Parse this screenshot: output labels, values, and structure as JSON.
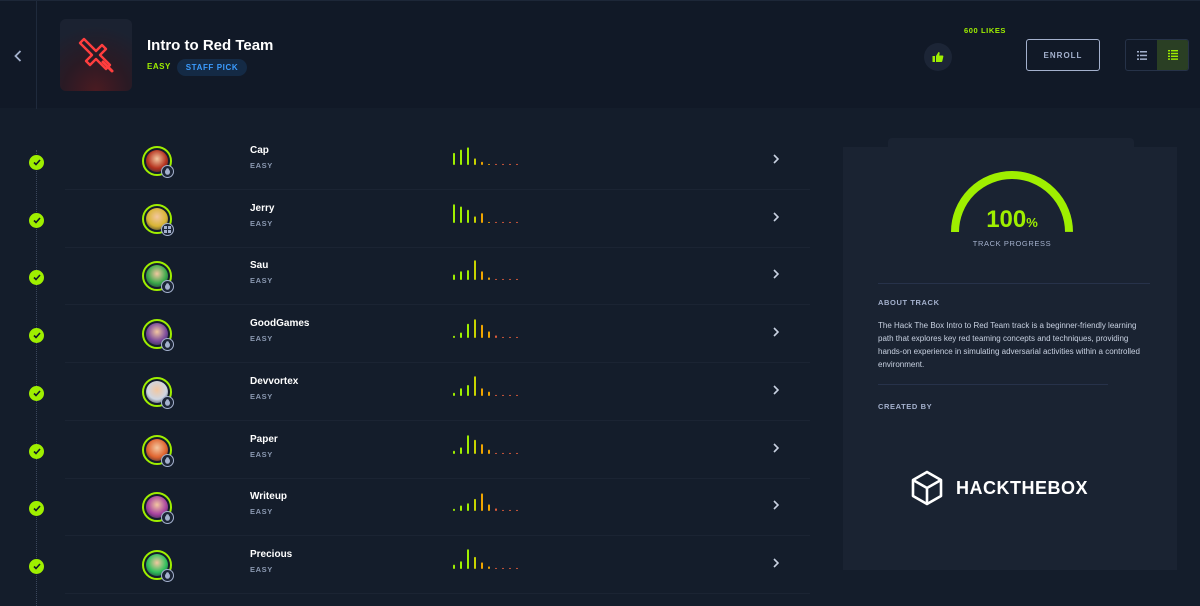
{
  "header": {
    "title": "Intro to Red Team",
    "difficulty": "EASY",
    "badge": "STAFF PICK",
    "likes": "600 LIKES",
    "enroll": "ENROLL"
  },
  "colors": {
    "accent": "#9fef00",
    "background": "#141d2b",
    "panel": "#1a2332",
    "badge_text": "#3b9cff",
    "rating_mid": "#f0a500",
    "rating_low": "#e35d3c",
    "track_icon": "#ff3e3e"
  },
  "machines": [
    {
      "name": "Cap",
      "difficulty": "EASY",
      "os": "linux",
      "face": "#b5331f",
      "ratings": [
        0.55,
        0.7,
        0.8,
        0.3,
        0.15,
        0.05,
        0.05,
        0.05,
        0.05,
        0.05
      ]
    },
    {
      "name": "Jerry",
      "difficulty": "EASY",
      "os": "windows",
      "face": "#d8b434",
      "ratings": [
        0.85,
        0.75,
        0.6,
        0.3,
        0.45,
        0.05,
        0.05,
        0.05,
        0.05,
        0.05
      ]
    },
    {
      "name": "Sau",
      "difficulty": "EASY",
      "os": "linux",
      "face": "#3aa84a",
      "ratings": [
        0.25,
        0.4,
        0.45,
        0.9,
        0.4,
        0.12,
        0.05,
        0.05,
        0.05,
        0.05
      ]
    },
    {
      "name": "GoodGames",
      "difficulty": "EASY",
      "os": "linux",
      "face": "#7a4a9c",
      "ratings": [
        0.1,
        0.25,
        0.65,
        0.85,
        0.6,
        0.3,
        0.12,
        0.05,
        0.05,
        0.05
      ]
    },
    {
      "name": "Devvortex",
      "difficulty": "EASY",
      "os": "linux",
      "face": "#cfd6e2",
      "ratings": [
        0.15,
        0.35,
        0.5,
        0.9,
        0.35,
        0.2,
        0.05,
        0.05,
        0.05,
        0.05
      ]
    },
    {
      "name": "Paper",
      "difficulty": "EASY",
      "os": "linux",
      "face": "#e0642f",
      "ratings": [
        0.15,
        0.3,
        0.85,
        0.65,
        0.45,
        0.2,
        0.05,
        0.05,
        0.05,
        0.05
      ]
    },
    {
      "name": "Writeup",
      "difficulty": "EASY",
      "os": "linux",
      "face": "#a843a0",
      "ratings": [
        0.1,
        0.25,
        0.35,
        0.55,
        0.8,
        0.3,
        0.12,
        0.05,
        0.05,
        0.05
      ]
    },
    {
      "name": "Precious",
      "difficulty": "EASY",
      "os": "linux",
      "face": "#2fbf5c",
      "ratings": [
        0.2,
        0.35,
        0.9,
        0.55,
        0.3,
        0.12,
        0.05,
        0.05,
        0.05,
        0.05
      ]
    }
  ],
  "panel": {
    "progress_value": "100",
    "progress_unit": "%",
    "progress_fraction": 1.0,
    "progress_label": "TRACK PROGRESS",
    "about_label": "ABOUT TRACK",
    "about_text": "The Hack The Box Intro to Red Team track is a beginner-friendly learning path that explores key red teaming concepts and techniques, providing hands-on experience in simulating adversarial activities within a controlled environment.",
    "created_by_label": "CREATED BY",
    "creator_logo_text": "HACKTHEBOX"
  }
}
